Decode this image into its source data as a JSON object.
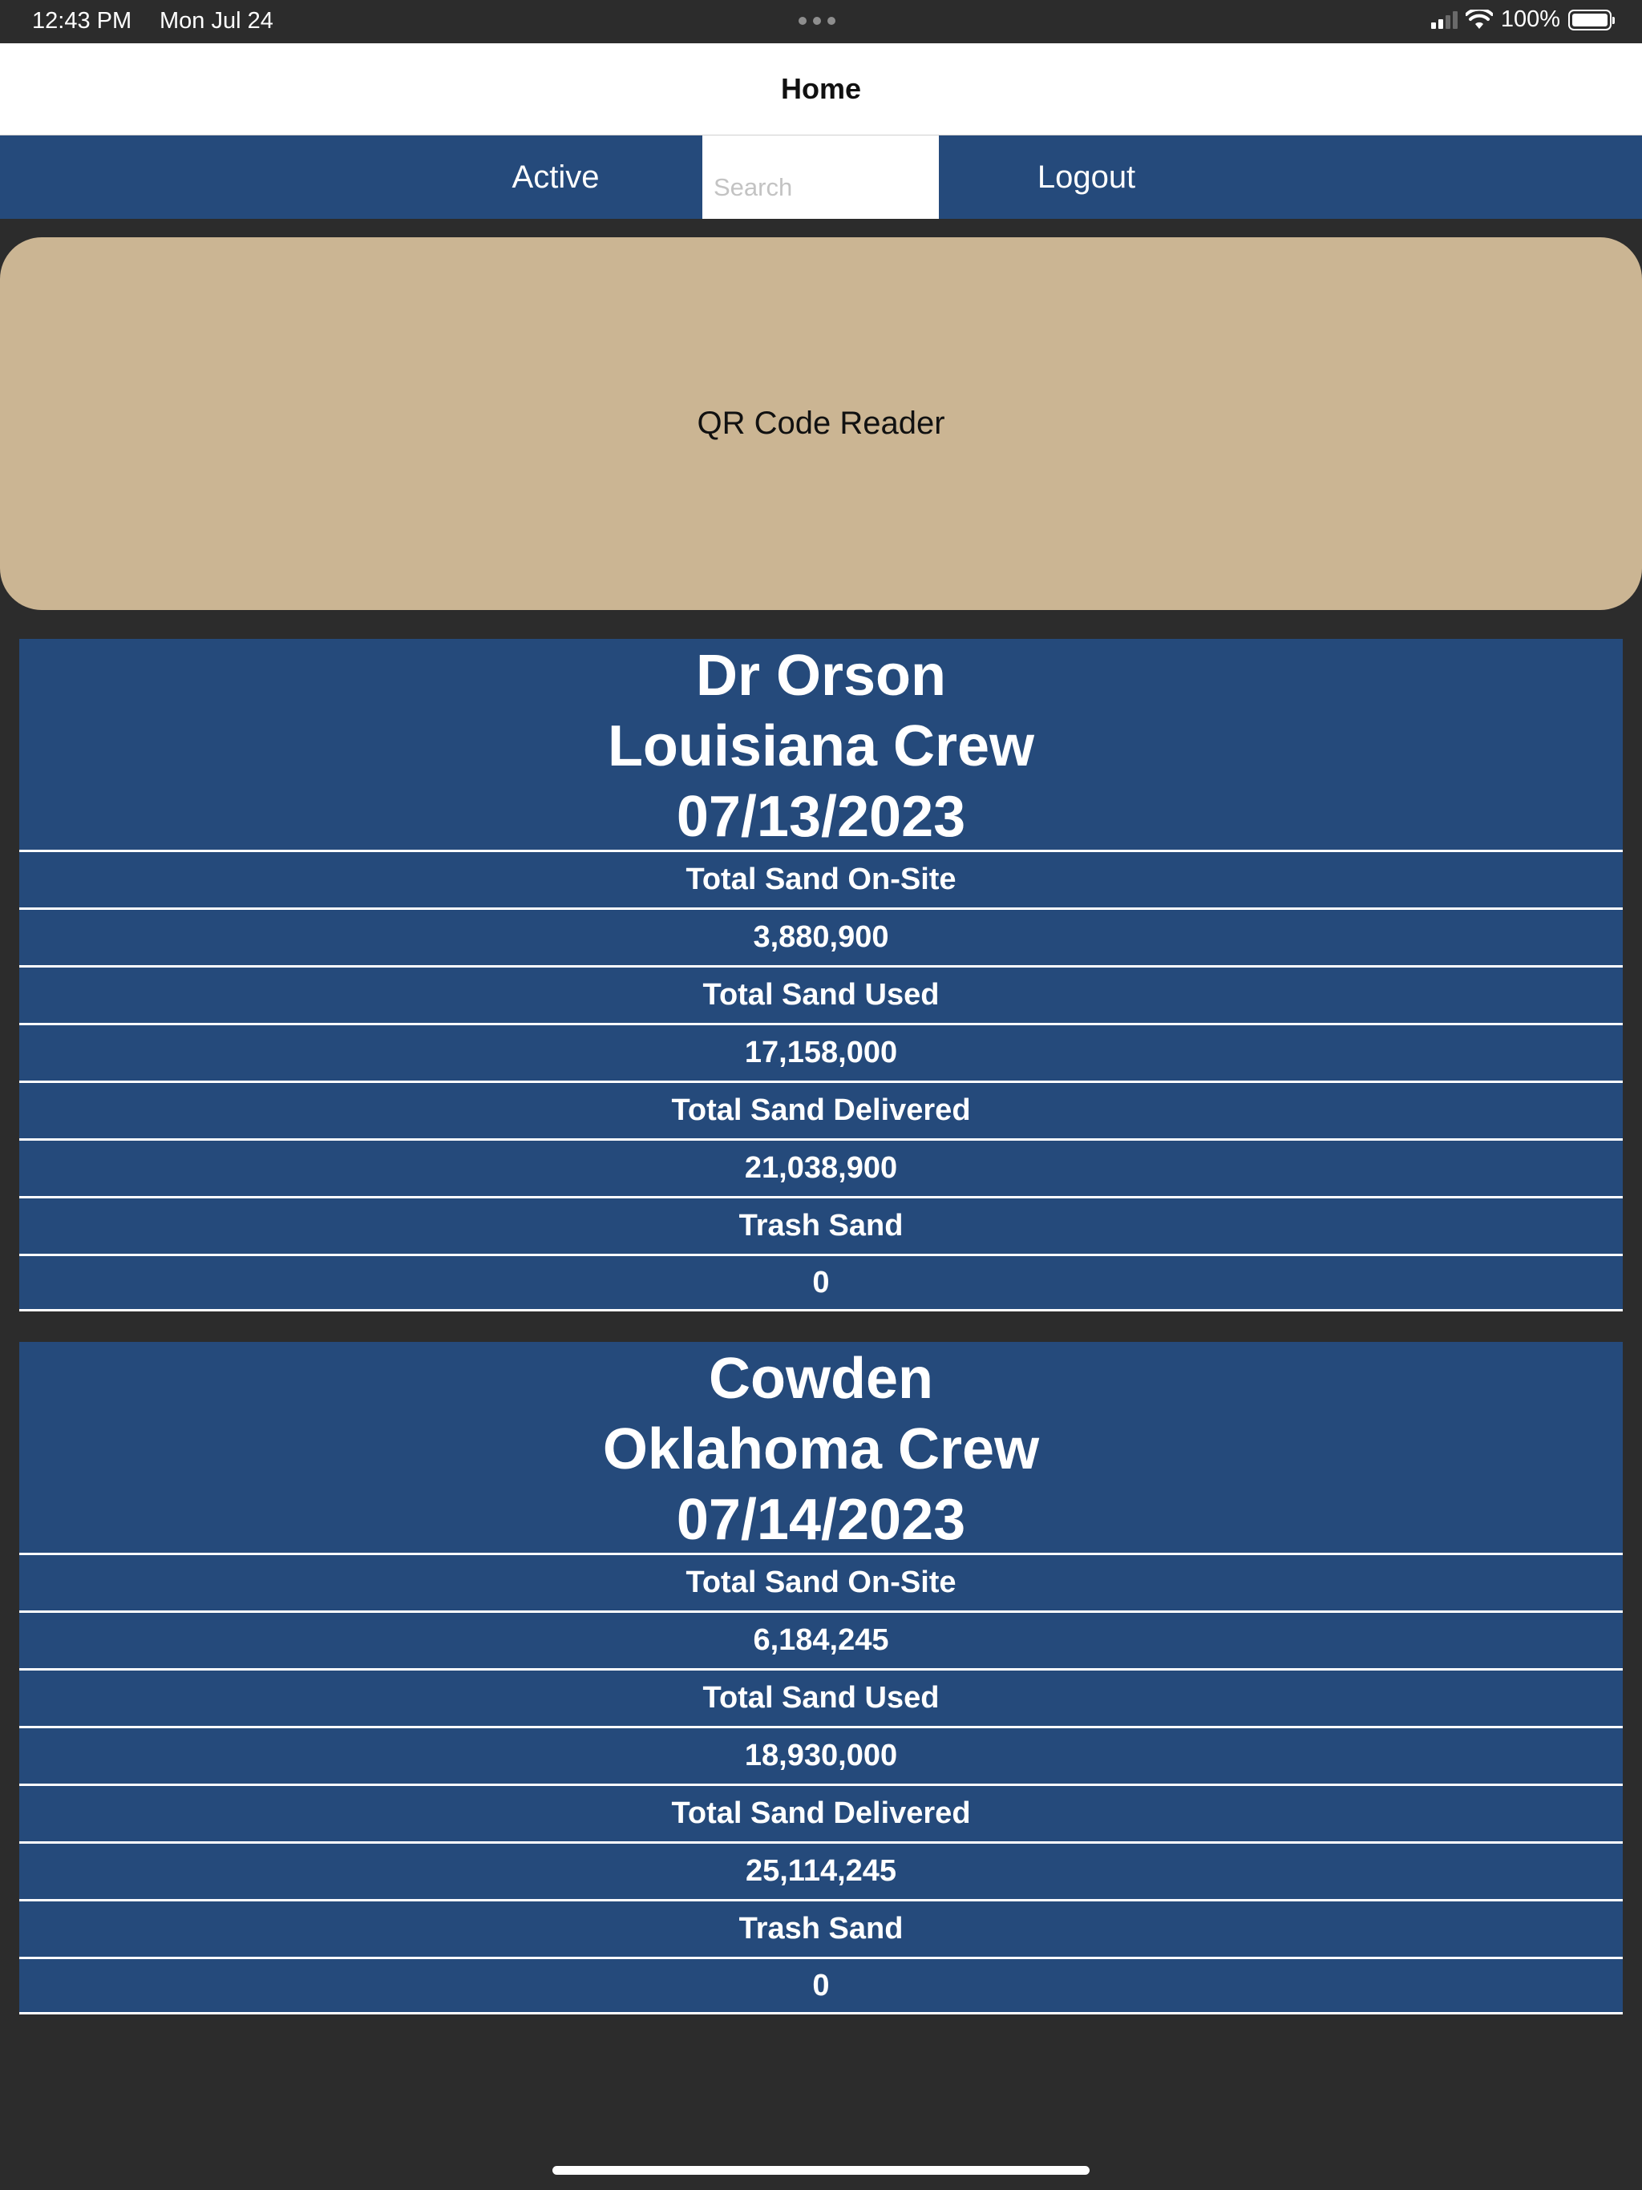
{
  "status_bar": {
    "time": "12:43 PM",
    "date": "Mon Jul 24",
    "battery": "100%"
  },
  "nav": {
    "title": "Home"
  },
  "toolbar": {
    "active_label": "Active",
    "search_placeholder": "Search",
    "logout_label": "Logout"
  },
  "qr_reader": {
    "label": "QR Code Reader"
  },
  "cards": [
    {
      "site": "Dr Orson",
      "crew": "Louisiana Crew",
      "date": "07/13/2023",
      "rows": [
        "Total Sand On-Site",
        "3,880,900",
        "Total Sand Used",
        "17,158,000",
        "Total Sand Delivered",
        "21,038,900",
        "Trash Sand",
        "0"
      ]
    },
    {
      "site": "Cowden",
      "crew": "Oklahoma Crew",
      "date": "07/14/2023",
      "rows": [
        "Total Sand On-Site",
        "6,184,245",
        "Total Sand Used",
        "18,930,000",
        "Total Sand Delivered",
        "25,114,245",
        "Trash Sand",
        "0"
      ]
    }
  ],
  "colors": {
    "background": "#2c2c2c",
    "toolbar": "#254a7b",
    "card": "#254a7b",
    "qr_reader": "#cbb593"
  }
}
